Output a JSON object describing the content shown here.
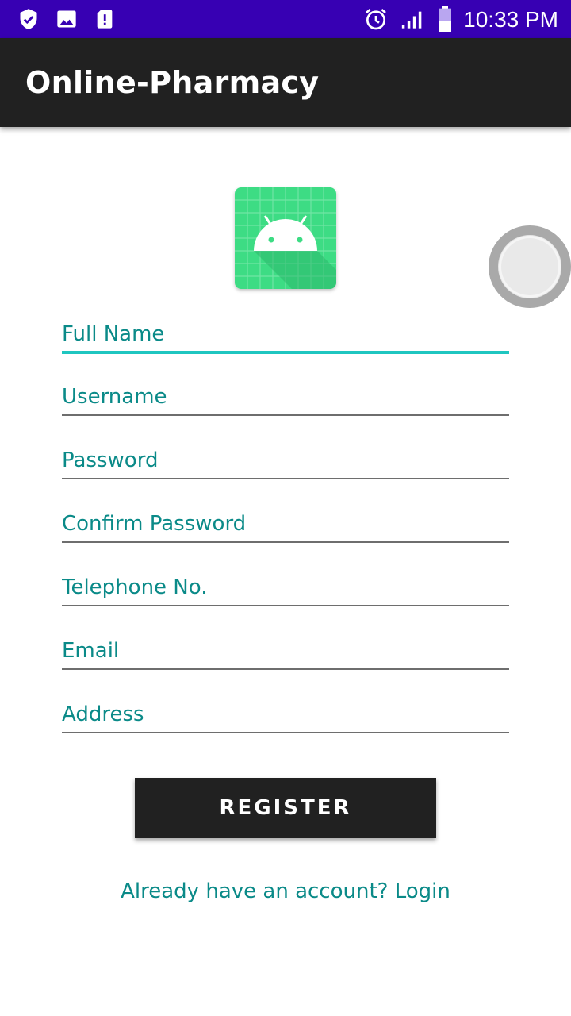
{
  "status_bar": {
    "time": "10:33 PM",
    "left_icons": [
      "shield-check-icon",
      "image-icon",
      "sd-card-alert-icon"
    ],
    "right_icons": [
      "alarm-icon",
      "signal-icon",
      "battery-icon"
    ],
    "color": "#3700b3"
  },
  "toolbar": {
    "title": "Online-Pharmacy",
    "color": "#212121"
  },
  "logo": {
    "icon": "android-app-icon",
    "color": "#3ddc84"
  },
  "form": {
    "fields": [
      {
        "placeholder": "Full Name"
      },
      {
        "placeholder": "Username"
      },
      {
        "placeholder": "Password"
      },
      {
        "placeholder": "Confirm Password"
      },
      {
        "placeholder": "Telephone No."
      },
      {
        "placeholder": "Email"
      },
      {
        "placeholder": "Address"
      }
    ],
    "accent_color": "#1fc6c0",
    "hint_color": "#0a8a88"
  },
  "register_button": {
    "label": "REGISTER"
  },
  "login_link": {
    "label": "Already have an account? Login"
  }
}
